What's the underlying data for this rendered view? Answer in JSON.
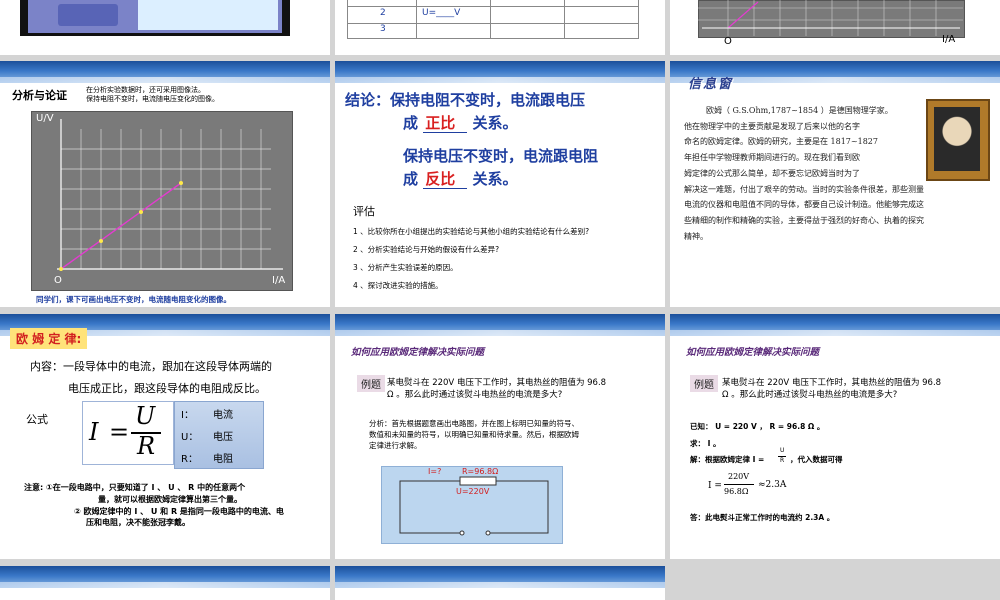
{
  "slide1": {
    "table_rows": [
      "2",
      "3"
    ],
    "u_label": "U=____V"
  },
  "slide2": {
    "origin": "O",
    "x_axis": "I/A"
  },
  "slide4": {
    "heading": "分析与论证",
    "note_line1": "在分析实验数据时，还可采用图像法。",
    "note_line2": "保持电阻不变时，电流随电压变化的图像。",
    "y_axis": "U/V",
    "x_axis": "I/A",
    "origin": "O",
    "caption": "同学们，课下可画出电压不变时，电流随电阻变化的图像。"
  },
  "slide5": {
    "conclusion_l1": "结论：保持电阻不变时，电流跟电压",
    "conclusion_l2a": "成",
    "blank1": "正比",
    "conclusion_l2b": "关系。",
    "conclusion_l3": "保持电压不变时，电流跟电阻",
    "conclusion_l4a": "成",
    "blank2": "反比",
    "conclusion_l4b": "关系。",
    "eval_title": "评估",
    "eval_items": [
      "1 、比较你所在小组提出的实验结论与其他小组的实验结论有什么差别?",
      "2 、分析实验结论与开始的假设有什么差异?",
      "3 、分析产生实验误差的原因。",
      "4 、探讨改进实验的措施。"
    ]
  },
  "slide6": {
    "title": "信息窗",
    "paragraph": [
      "欧姆（ G.S.Ohm,1787~1854 ）是德国物理学家。",
      "他在物理学中的主要贡献是发现了后来以他的名字",
      "命名的欧姆定律。欧姆的研究，主要是在 1817~1827",
      "年担任中学物理教师期间进行的。现在我们看到欧",
      "姆定律的公式那么简单，却不要忘记欧姆当时为了",
      "解决这一难题，付出了艰辛的劳动。当时的实验条件很差，那些测量",
      "电流的仪器和电阻值不同的导体，都要自己设计制造。他能够完成这",
      "些精细的制作和精确的实验，主要得益于强烈的好奇心、执着的探究",
      "精神。"
    ]
  },
  "slide7": {
    "title": "欧 姆 定 律:",
    "content_l1": "内容：一段导体中的电流，跟加在这段导体两端的",
    "content_l2": "电压成正比，跟这段导体的电阻成反比。",
    "formula_label": "公式",
    "formula_I": "I",
    "formula_eq": "=",
    "formula_U": "U",
    "formula_R": "R",
    "legend": [
      {
        "sym": "I：",
        "desc": "电流"
      },
      {
        "sym": "U：",
        "desc": "电压"
      },
      {
        "sym": "R：",
        "desc": "电阻"
      }
    ],
    "note_l1": "注意: ①在一段电路中，只要知道了 I 、 U 、 R 中的任意两个",
    "note_l2": "量，就可以根据欧姆定律算出第三个量。",
    "note_l3": "② 欧姆定律中的 I 、 U 和 R 是指同一段电路中的电流、电",
    "note_l4": "压和电阻，决不能张冠李戴。"
  },
  "slide8": {
    "title": "如何应用欧姆定律解决实际问题",
    "example_tag": "例题",
    "problem_l1": "某电熨斗在 220V 电压下工作时，其电热丝的阻值为 96.8",
    "problem_l2": "Ω 。那么此时通过该熨斗电热丝的电流是多大?",
    "analysis_l1": "分析：首先根据题意画出电路图，并在图上标明已知量的符号、",
    "analysis_l2": "数值和未知量的符号，以明确已知量和待求量。然后，根据欧姆",
    "analysis_l3": "定律进行求解。",
    "circuit_i": "I=?",
    "circuit_r": "R=96.8Ω",
    "circuit_u": "U=220V"
  },
  "slide9": {
    "title": "如何应用欧姆定律解决实际问题",
    "example_tag": "例题",
    "problem_l1": "某电熨斗在 220V 电压下工作时，其电热丝的阻值为 96.8",
    "problem_l2": "Ω 。那么此时通过该熨斗电热丝的电流是多大?",
    "known": "已知： U = 220 V ， R = 96.8 Ω 。",
    "find": "求： I 。",
    "solve_a": "解：根据欧姆定律 I =",
    "solve_frac_num": "U",
    "solve_frac_den": "R",
    "solve_b": "，代入数据可得",
    "calc_I": "I =",
    "calc_num": "220V",
    "calc_den": "96.8Ω",
    "calc_res": "≈2.3A",
    "answer": "答：此电熨斗正常工作时的电流约 2.3A 。"
  }
}
